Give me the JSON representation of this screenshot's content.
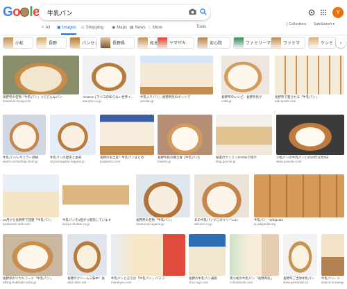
{
  "logo": {
    "letters": [
      "G",
      "o",
      "o",
      "g",
      "l",
      "e"
    ]
  },
  "search": {
    "query": "牛乳パン"
  },
  "tabs": [
    {
      "label": "All",
      "icon": "search-icon"
    },
    {
      "label": "Images",
      "icon": "image-icon",
      "active": true
    },
    {
      "label": "Shopping",
      "icon": "tag-icon"
    },
    {
      "label": "Maps",
      "icon": "map-pin-icon"
    },
    {
      "label": "News",
      "icon": "news-icon"
    },
    {
      "label": "More",
      "icon": "more-vert-icon"
    }
  ],
  "tools_label": "Tools",
  "collections_label": "Collections",
  "safesearch_label": "SafeSearch ▾",
  "avatar_letter": "Y",
  "chips": [
    {
      "label": "小松"
    },
    {
      "label": "長野"
    },
    {
      "label": "パンセット"
    },
    {
      "label": "長野県"
    },
    {
      "label": "松本"
    },
    {
      "label": "ヤマザキ"
    },
    {
      "label": "安心院"
    },
    {
      "label": "ファミリーマート"
    },
    {
      "label": "ファミマ"
    },
    {
      "label": "ケンミ"
    }
  ],
  "results": [
    {
      "caption": "長野県の名物「牛乳パン」ってどんなパン",
      "domain": "favtennis-moog.com"
    },
    {
      "caption": "Amazon | マツコの知らない世界 TBS 牛乳パン",
      "domain": "amazon.co.jp"
    },
    {
      "caption": "牛乳入りパン」長野県民のネットで",
      "domain": "ameblo.jp"
    },
    {
      "caption": "長野県のレシピ、長野県民が",
      "domain": "cotta.jp"
    },
    {
      "caption": "長野県で愛される「牛乳パン」",
      "domain": "tabi-tyoshi.com"
    },
    {
      "caption": "牛乳パン/レギュラー価格",
      "domain": "watch-orchestrap.store.jp"
    },
    {
      "caption": "牛乳パンの歴史と由来",
      "domain": "city.komagane.nagano.jp"
    },
    {
      "caption": "長野のお土産！牛乳パンまとめ",
      "domain": "jorgaseco.com"
    },
    {
      "caption": "長野県民の郷土食【牛乳パン】",
      "domain": "tmwrks.jp"
    },
    {
      "caption": "秘密のケンミンSHOWで紹介",
      "domain": "blog.goo.ne.jp"
    },
    {
      "caption": "小松パンの牛乳パン | 2019年11月3日",
      "domain": "www.youtube.com"
    },
    {
      "caption": "10月から長野県で話題「牛乳パン」",
      "domain": "kyobunshi-web.com"
    },
    {
      "caption": "牛乳パンを1個ずつ販売しています",
      "domain": "kanyu-chudan.co.jp"
    },
    {
      "caption": "長野県の名物「牛乳パン」",
      "domain": "rtnanuroji-nagano.jp"
    },
    {
      "caption": "あの牛乳パンがこのクリームに",
      "domain": "athome.co.jp"
    },
    {
      "caption": "牛乳パン - Wikipedia",
      "domain": "ja.wikipedia.org"
    },
    {
      "caption": "長野県のソウルフード「牛乳パン」",
      "domain": "tdblog-hokkaido-aobo.jp"
    },
    {
      "caption": "長野のクリーム三昧中！長",
      "domain": "aiku-clinic.net"
    },
    {
      "caption": "牛乳パンと言えば「牛乳パン」パスコ",
      "domain": "marukyou.com"
    },
    {
      "caption": "長野の牛乳パン通販",
      "domain": "chco-ago.com"
    },
    {
      "caption": "南小松の牛乳パン「長野県民」",
      "domain": "m.facebook.com"
    },
    {
      "caption": "長野県ご当地牛乳パン",
      "domain": "www.yamazaki.cd"
    },
    {
      "caption": "牛乳パン - ミルク味パン",
      "domain": "search-snowing-store.jp"
    }
  ]
}
